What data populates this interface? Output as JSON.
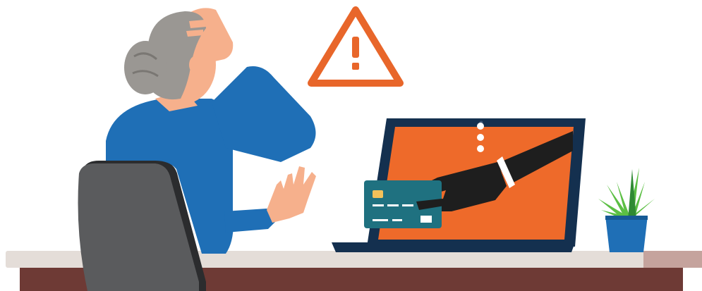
{
  "scene": {
    "subject": "phishing-scam-illustration",
    "elements": [
      "warning-sign-icon",
      "woman-figure",
      "office-chair",
      "laptop",
      "hand-with-credit-card",
      "potted-plant",
      "desk"
    ]
  },
  "colors": {
    "background": "#ffffff",
    "warning_orange": "#e8662a",
    "screen_orange": "#ee6a2a",
    "laptop_navy": "#14304f",
    "sweater_blue": "#1f6fb6",
    "skin": "#f6b08c",
    "hair_gray": "#9a9793",
    "chair_gray": "#5a5b5d",
    "card_teal": "#1f7180",
    "hand_dark": "#1e1e1e",
    "plant_green": "#5cbf44",
    "pot_blue": "#1f6fb6",
    "desk_top": "#e4ddd8",
    "desk_body": "#6e3a35"
  }
}
